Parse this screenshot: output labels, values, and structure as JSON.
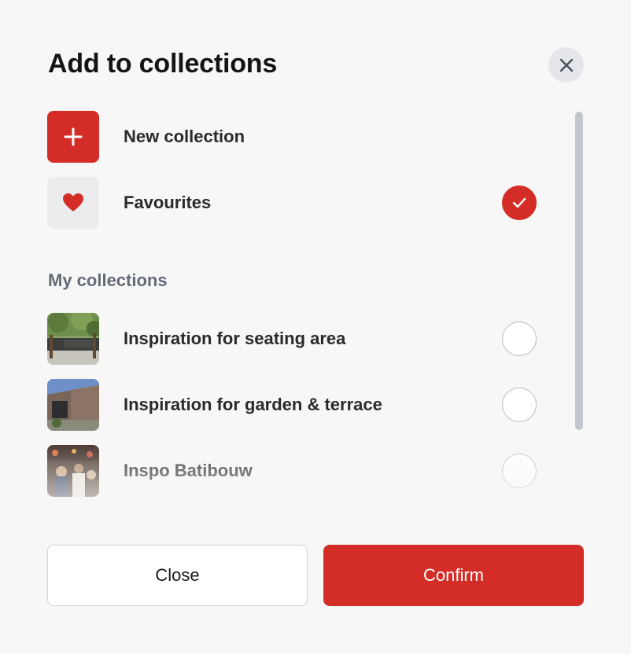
{
  "dialog": {
    "title": "Add to collections",
    "close_icon": "close-icon"
  },
  "actions": {
    "new_collection": {
      "label": "New collection",
      "icon": "plus-icon"
    },
    "favourites": {
      "label": "Favourites",
      "icon": "heart-icon",
      "checked": true
    }
  },
  "section_title": "My collections",
  "collections": [
    {
      "label": "Inspiration for seating area",
      "checked": false
    },
    {
      "label": "Inspiration for garden & terrace",
      "checked": false
    },
    {
      "label": "Inspo Batibouw",
      "checked": false
    }
  ],
  "footer": {
    "close_label": "Close",
    "confirm_label": "Confirm"
  },
  "colors": {
    "accent": "#d42d27",
    "background": "#f7f7f7",
    "muted_text": "#646b78"
  }
}
